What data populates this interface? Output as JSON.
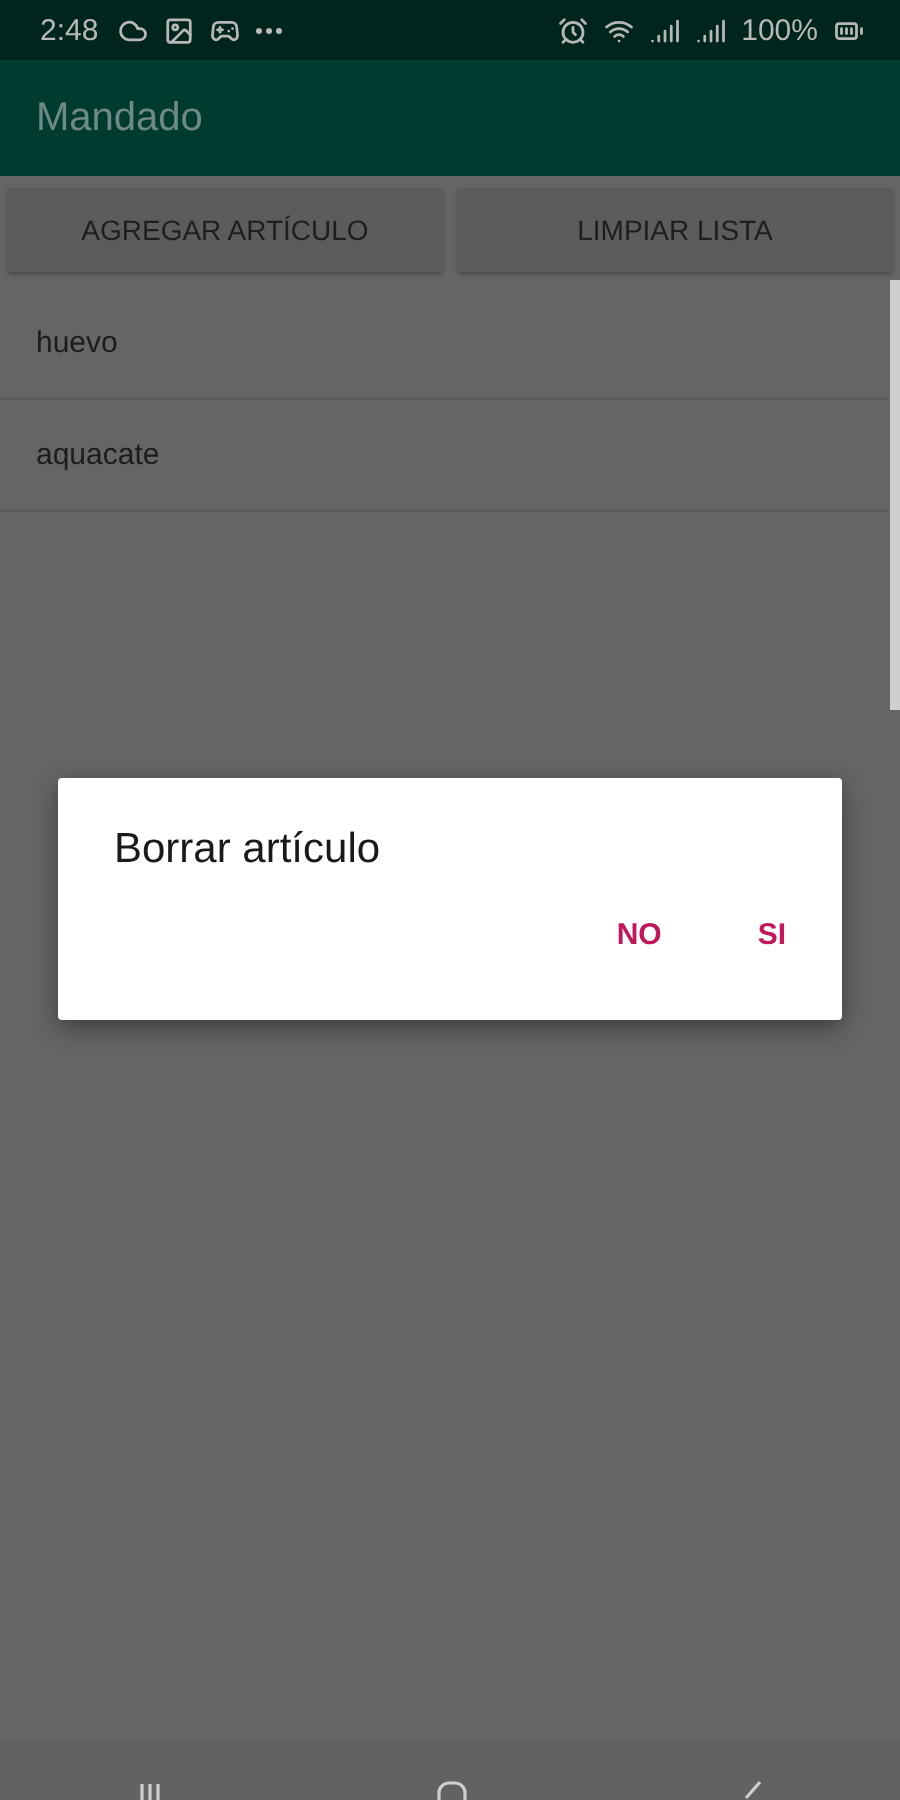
{
  "status_bar": {
    "time": "2:48",
    "battery": "100%"
  },
  "app_bar": {
    "title": "Mandado"
  },
  "buttons": [
    "AGREGAR ARTÍCULO",
    "LIMPIAR LISTA"
  ],
  "items": [
    "huevo",
    "aquacate"
  ],
  "dialog": {
    "title": "Borrar artículo",
    "actions": [
      "NO",
      "SI"
    ]
  }
}
